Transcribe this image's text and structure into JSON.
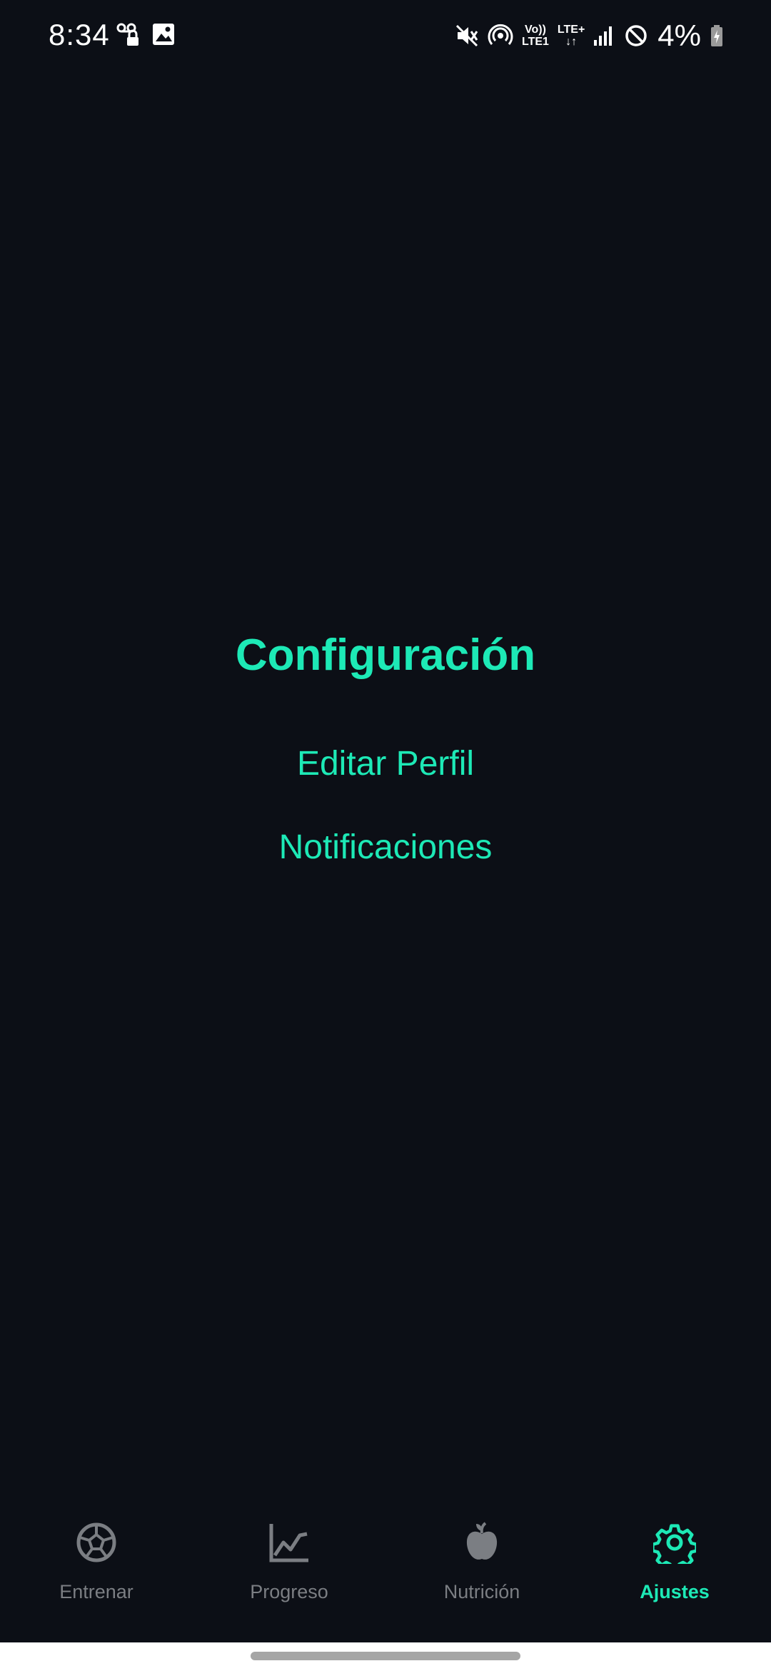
{
  "status_bar": {
    "time": "8:34",
    "net_top_left": "Vo))",
    "net_bottom_left": "LTE1",
    "net_top_right": "LTE+",
    "net_bottom_right": "↓↑",
    "battery": "4%"
  },
  "main": {
    "title": "Configuración",
    "menu": [
      {
        "label": "Editar Perfil"
      },
      {
        "label": "Notificaciones"
      }
    ]
  },
  "bottom_nav": {
    "items": [
      {
        "label": "Entrenar",
        "icon": "soccer-ball-icon",
        "active": false
      },
      {
        "label": "Progreso",
        "icon": "chart-line-icon",
        "active": false
      },
      {
        "label": "Nutrición",
        "icon": "apple-icon",
        "active": false
      },
      {
        "label": "Ajustes",
        "icon": "gear-icon",
        "active": true
      }
    ]
  },
  "colors": {
    "background": "#0c0f16",
    "accent": "#1de9b6",
    "inactive": "#7b7e83"
  }
}
